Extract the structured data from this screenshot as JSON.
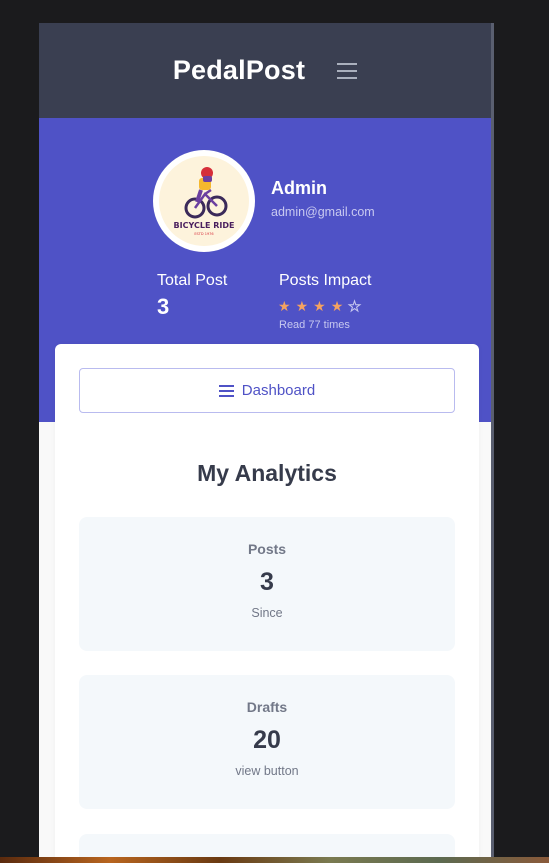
{
  "header": {
    "brand": "PedalPost",
    "menu_icon": "hamburger-icon"
  },
  "profile": {
    "name": "Admin",
    "email": "admin@gmail.com",
    "avatar_logo_text": [
      "BICYCLE RIDE",
      "ESTD 1976"
    ],
    "total_post_label": "Total Post",
    "total_post_value": "3",
    "impact_label": "Posts Impact",
    "rating": 4,
    "rating_max": 5,
    "read_text": "Read 77 times",
    "colors": {
      "star": "#f4a261",
      "band": "#4f52c6",
      "header": "#3a3f51"
    }
  },
  "dashboard_button": {
    "label": "Dashboard",
    "icon": "hamburger-icon"
  },
  "analytics": {
    "title": "My Analytics",
    "cards": [
      {
        "label": "Posts",
        "value": "3",
        "sub": "Since"
      },
      {
        "label": "Drafts",
        "value": "20",
        "sub": "view button"
      }
    ]
  }
}
